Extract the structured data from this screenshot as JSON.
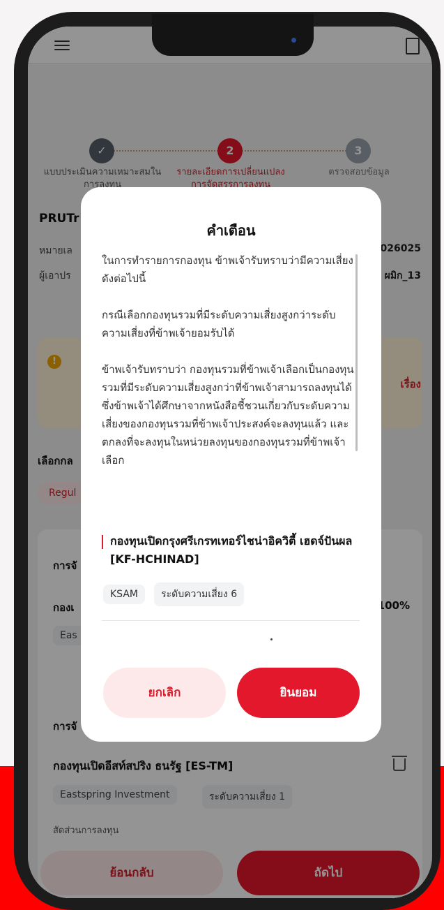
{
  "app": {
    "company_short": "PRUTr",
    "info_row1_label": "หมายเล",
    "info_row1_value": "026025",
    "info_row2_label": "ผู้เอาปร",
    "info_row2_value": "ผมิก_13",
    "warning_link": "เรื่อง",
    "section_label": "เลือกกล",
    "chip_regular": "Regul",
    "alloc_label_1": "การจั",
    "fund_label_1": "กองเ",
    "tag_1": "Eas",
    "alloc_pct": "100%",
    "alloc_label_2": "การจั",
    "fund_name_2": "กองทุนเปิดอีสท์สปริง ธนรัฐ [ES-TM]",
    "fund_2_tag_company": "Eastspring Investment",
    "fund_2_tag_risk": "ระดับความเสี่ยง 1",
    "ratio_label": "สัดส่วนการลงทุน",
    "back_button": "ย้อนกลับ",
    "next_button": "ถัดไป"
  },
  "stepper": {
    "steps": [
      {
        "label": "แบบประเมินความเหมาะสมในการลงทุน",
        "state": "done",
        "number": "✓"
      },
      {
        "label": "รายละเอียดการเปลี่ยนแปลงการจัดสรรการลงทุน",
        "state": "active",
        "number": "2"
      },
      {
        "label": "ตรวจสอบข้อมูล",
        "state": "pending",
        "number": "3"
      }
    ]
  },
  "modal": {
    "title": "คำเตือน",
    "paragraph_1": "ในการทำรายการกองทุน ข้าพเจ้ารับทราบว่ามีความเสี่ยงดังต่อไปนี้",
    "paragraph_2": "กรณีเลือกกองทุนรวมที่มีระดับความเสี่ยงสูงกว่าระดับความเสี่ยงที่ข้าพเจ้ายอมรับได้",
    "paragraph_3": "ข้าพเจ้ารับทราบว่า กองทุนรวมที่ข้าพเจ้าเลือกเป็นกองทุนรวมที่มีระดับความเสี่ยงสูงกว่าที่ข้าพเจ้าสามารถลงทุนได้ ซึ่งข้าพเจ้าได้ศึกษาจากหนังสือชี้ชวนเกี่ยวกับระดับความเสี่ยงของกองทุนรวมที่ข้าพเจ้าประสงค์จะลงทุนแล้ว และตกลงที่จะลงทุนในหน่วยลงทุนของกองทุนรวมที่ข้าพเจ้าเลือก",
    "fund_name": "กองทุนเปิดกรุงศรีเกรทเทอร์ไชน่าอิควิตี้ เฮดจ์ปันผล [KF-HCHINAD]",
    "fund_company": "KSAM",
    "fund_risk": "ระดับความเสี่ยง 6",
    "cancel_button": "ยกเลิก",
    "accept_button": "ยินยอม"
  },
  "colors": {
    "brand_red": "#e4182c",
    "done_step": "#555f6a",
    "pending_step": "#9aa3ad"
  }
}
